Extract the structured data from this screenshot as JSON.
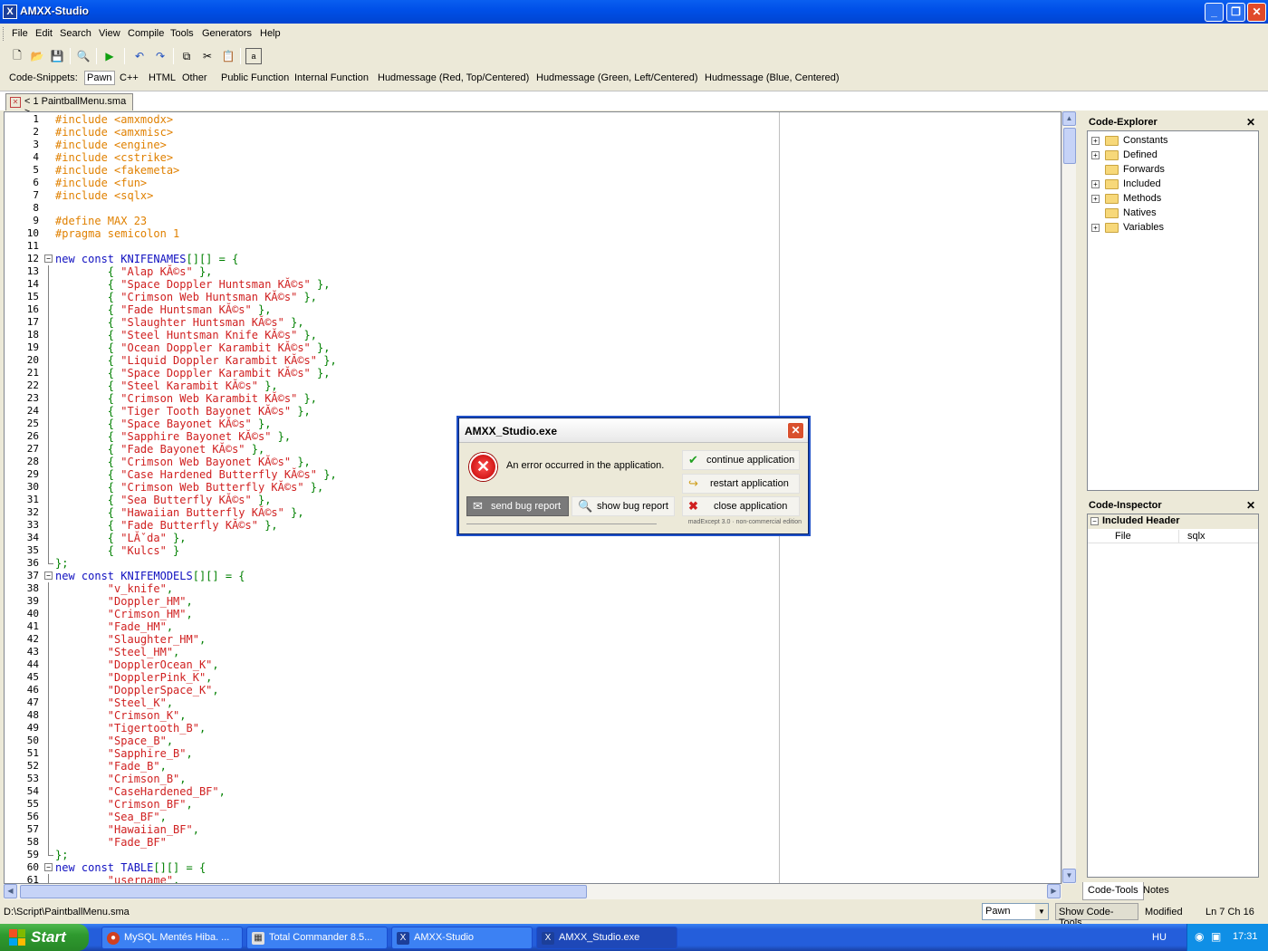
{
  "window": {
    "title": "AMXX-Studio"
  },
  "menu": [
    "File",
    "Edit",
    "Search",
    "View",
    "Compile",
    "Tools",
    "Generators",
    "Help"
  ],
  "toolbar_icons": [
    "new-file-icon",
    "open-folder-icon",
    "save-icon",
    "search-icon",
    "compile-run-icon",
    "undo-icon",
    "redo-icon",
    "copy-icon",
    "cut-icon",
    "paste-icon",
    "select-all-icon"
  ],
  "snippets": {
    "label": "Code-Snippets:",
    "items": [
      "Pawn",
      "C++",
      "HTML",
      "Other",
      "Public Function",
      "Internal Function",
      "Hudmessage (Red, Top/Centered)",
      "Hudmessage (Green, Left/Centered)",
      "Hudmessage (Blue, Centered)"
    ]
  },
  "doc_tab": {
    "label": "< 1 PaintballMenu.sma >"
  },
  "code": [
    [
      {
        "t": "#include <amxmodx>",
        "c": "pre"
      }
    ],
    [
      {
        "t": "#include <amxmisc>",
        "c": "pre"
      }
    ],
    [
      {
        "t": "#include <engine>",
        "c": "pre"
      }
    ],
    [
      {
        "t": "#include <cstrike>",
        "c": "pre"
      }
    ],
    [
      {
        "t": "#include <fakemeta>",
        "c": "pre"
      }
    ],
    [
      {
        "t": "#include <fun>",
        "c": "pre"
      }
    ],
    [
      {
        "t": "#include <sqlx>",
        "c": "pre"
      }
    ],
    [],
    [
      {
        "t": "#define MAX 23",
        "c": "pre"
      }
    ],
    [
      {
        "t": "#pragma semicolon 1",
        "c": "pre"
      }
    ],
    [],
    [
      {
        "t": "new const ",
        "c": "kw"
      },
      {
        "t": "KNIFENAMES",
        "c": "id"
      },
      {
        "t": "[][] = {",
        "c": "op"
      }
    ],
    [
      {
        "t": "        { ",
        "c": "op"
      },
      {
        "t": "\"Alap KĂ©s\"",
        "c": "str"
      },
      {
        "t": " },",
        "c": "op"
      }
    ],
    [
      {
        "t": "        { ",
        "c": "op"
      },
      {
        "t": "\"Space Doppler Huntsman KĂ©s\"",
        "c": "str"
      },
      {
        "t": " },",
        "c": "op"
      }
    ],
    [
      {
        "t": "        { ",
        "c": "op"
      },
      {
        "t": "\"Crimson Web Huntsman KĂ©s\"",
        "c": "str"
      },
      {
        "t": " },",
        "c": "op"
      }
    ],
    [
      {
        "t": "        { ",
        "c": "op"
      },
      {
        "t": "\"Fade Huntsman KĂ©s\"",
        "c": "str"
      },
      {
        "t": " },",
        "c": "op"
      }
    ],
    [
      {
        "t": "        { ",
        "c": "op"
      },
      {
        "t": "\"Slaughter Huntsman KĂ©s\"",
        "c": "str"
      },
      {
        "t": " },",
        "c": "op"
      }
    ],
    [
      {
        "t": "        { ",
        "c": "op"
      },
      {
        "t": "\"Steel Huntsman Knife KĂ©s\"",
        "c": "str"
      },
      {
        "t": " },",
        "c": "op"
      }
    ],
    [
      {
        "t": "        { ",
        "c": "op"
      },
      {
        "t": "\"Ocean Doppler Karambit KĂ©s\"",
        "c": "str"
      },
      {
        "t": " },",
        "c": "op"
      }
    ],
    [
      {
        "t": "        { ",
        "c": "op"
      },
      {
        "t": "\"Liquid Doppler Karambit KĂ©s\"",
        "c": "str"
      },
      {
        "t": " },",
        "c": "op"
      }
    ],
    [
      {
        "t": "        { ",
        "c": "op"
      },
      {
        "t": "\"Space Doppler Karambit KĂ©s\"",
        "c": "str"
      },
      {
        "t": " },",
        "c": "op"
      }
    ],
    [
      {
        "t": "        { ",
        "c": "op"
      },
      {
        "t": "\"Steel Karambit KĂ©s\"",
        "c": "str"
      },
      {
        "t": " },",
        "c": "op"
      }
    ],
    [
      {
        "t": "        { ",
        "c": "op"
      },
      {
        "t": "\"Crimson Web Karambit KĂ©s\"",
        "c": "str"
      },
      {
        "t": " },",
        "c": "op"
      }
    ],
    [
      {
        "t": "        { ",
        "c": "op"
      },
      {
        "t": "\"Tiger Tooth Bayonet KĂ©s\"",
        "c": "str"
      },
      {
        "t": " },",
        "c": "op"
      }
    ],
    [
      {
        "t": "        { ",
        "c": "op"
      },
      {
        "t": "\"Space Bayonet KĂ©s\"",
        "c": "str"
      },
      {
        "t": " },",
        "c": "op"
      }
    ],
    [
      {
        "t": "        { ",
        "c": "op"
      },
      {
        "t": "\"Sapphire Bayonet KĂ©s\"",
        "c": "str"
      },
      {
        "t": " },",
        "c": "op"
      }
    ],
    [
      {
        "t": "        { ",
        "c": "op"
      },
      {
        "t": "\"Fade Bayonet KĂ©s\"",
        "c": "str"
      },
      {
        "t": " },",
        "c": "op"
      }
    ],
    [
      {
        "t": "        { ",
        "c": "op"
      },
      {
        "t": "\"Crimson Web Bayonet KĂ©s\"",
        "c": "str"
      },
      {
        "t": " },",
        "c": "op"
      }
    ],
    [
      {
        "t": "        { ",
        "c": "op"
      },
      {
        "t": "\"Case Hardened Butterfly KĂ©s\"",
        "c": "str"
      },
      {
        "t": " },",
        "c": "op"
      }
    ],
    [
      {
        "t": "        { ",
        "c": "op"
      },
      {
        "t": "\"Crimson Web Butterfly KĂ©s\"",
        "c": "str"
      },
      {
        "t": " },",
        "c": "op"
      }
    ],
    [
      {
        "t": "        { ",
        "c": "op"
      },
      {
        "t": "\"Sea Butterfly KĂ©s\"",
        "c": "str"
      },
      {
        "t": " },",
        "c": "op"
      }
    ],
    [
      {
        "t": "        { ",
        "c": "op"
      },
      {
        "t": "\"Hawaiian Butterfly KĂ©s\"",
        "c": "str"
      },
      {
        "t": " },",
        "c": "op"
      }
    ],
    [
      {
        "t": "        { ",
        "c": "op"
      },
      {
        "t": "\"Fade Butterfly KĂ©s\"",
        "c": "str"
      },
      {
        "t": " },",
        "c": "op"
      }
    ],
    [
      {
        "t": "        { ",
        "c": "op"
      },
      {
        "t": "\"LĂˇda\"",
        "c": "str"
      },
      {
        "t": " },",
        "c": "op"
      }
    ],
    [
      {
        "t": "        { ",
        "c": "op"
      },
      {
        "t": "\"Kulcs\"",
        "c": "str"
      },
      {
        "t": " }",
        "c": "op"
      }
    ],
    [
      {
        "t": "};",
        "c": "op"
      }
    ],
    [
      {
        "t": "new const ",
        "c": "kw"
      },
      {
        "t": "KNIFEMODELS",
        "c": "id"
      },
      {
        "t": "[][] = {",
        "c": "op"
      }
    ],
    [
      {
        "t": "        ",
        "c": "op"
      },
      {
        "t": "\"v_knife\"",
        "c": "str"
      },
      {
        "t": ",",
        "c": "op"
      }
    ],
    [
      {
        "t": "        ",
        "c": "op"
      },
      {
        "t": "\"Doppler_HM\"",
        "c": "str"
      },
      {
        "t": ",",
        "c": "op"
      }
    ],
    [
      {
        "t": "        ",
        "c": "op"
      },
      {
        "t": "\"Crimson_HM\"",
        "c": "str"
      },
      {
        "t": ",",
        "c": "op"
      }
    ],
    [
      {
        "t": "        ",
        "c": "op"
      },
      {
        "t": "\"Fade_HM\"",
        "c": "str"
      },
      {
        "t": ",",
        "c": "op"
      }
    ],
    [
      {
        "t": "        ",
        "c": "op"
      },
      {
        "t": "\"Slaughter_HM\"",
        "c": "str"
      },
      {
        "t": ",",
        "c": "op"
      }
    ],
    [
      {
        "t": "        ",
        "c": "op"
      },
      {
        "t": "\"Steel_HM\"",
        "c": "str"
      },
      {
        "t": ",",
        "c": "op"
      }
    ],
    [
      {
        "t": "        ",
        "c": "op"
      },
      {
        "t": "\"DopplerOcean_K\"",
        "c": "str"
      },
      {
        "t": ",",
        "c": "op"
      }
    ],
    [
      {
        "t": "        ",
        "c": "op"
      },
      {
        "t": "\"DopplerPink_K\"",
        "c": "str"
      },
      {
        "t": ",",
        "c": "op"
      }
    ],
    [
      {
        "t": "        ",
        "c": "op"
      },
      {
        "t": "\"DopplerSpace_K\"",
        "c": "str"
      },
      {
        "t": ",",
        "c": "op"
      }
    ],
    [
      {
        "t": "        ",
        "c": "op"
      },
      {
        "t": "\"Steel_K\"",
        "c": "str"
      },
      {
        "t": ",",
        "c": "op"
      }
    ],
    [
      {
        "t": "        ",
        "c": "op"
      },
      {
        "t": "\"Crimson_K\"",
        "c": "str"
      },
      {
        "t": ",",
        "c": "op"
      }
    ],
    [
      {
        "t": "        ",
        "c": "op"
      },
      {
        "t": "\"Tigertooth_B\"",
        "c": "str"
      },
      {
        "t": ",",
        "c": "op"
      }
    ],
    [
      {
        "t": "        ",
        "c": "op"
      },
      {
        "t": "\"Space_B\"",
        "c": "str"
      },
      {
        "t": ",",
        "c": "op"
      }
    ],
    [
      {
        "t": "        ",
        "c": "op"
      },
      {
        "t": "\"Sapphire_B\"",
        "c": "str"
      },
      {
        "t": ",",
        "c": "op"
      }
    ],
    [
      {
        "t": "        ",
        "c": "op"
      },
      {
        "t": "\"Fade_B\"",
        "c": "str"
      },
      {
        "t": ",",
        "c": "op"
      }
    ],
    [
      {
        "t": "        ",
        "c": "op"
      },
      {
        "t": "\"Crimson_B\"",
        "c": "str"
      },
      {
        "t": ",",
        "c": "op"
      }
    ],
    [
      {
        "t": "        ",
        "c": "op"
      },
      {
        "t": "\"CaseHardened_BF\"",
        "c": "str"
      },
      {
        "t": ",",
        "c": "op"
      }
    ],
    [
      {
        "t": "        ",
        "c": "op"
      },
      {
        "t": "\"Crimson_BF\"",
        "c": "str"
      },
      {
        "t": ",",
        "c": "op"
      }
    ],
    [
      {
        "t": "        ",
        "c": "op"
      },
      {
        "t": "\"Sea_BF\"",
        "c": "str"
      },
      {
        "t": ",",
        "c": "op"
      }
    ],
    [
      {
        "t": "        ",
        "c": "op"
      },
      {
        "t": "\"Hawaiian_BF\"",
        "c": "str"
      },
      {
        "t": ",",
        "c": "op"
      }
    ],
    [
      {
        "t": "        ",
        "c": "op"
      },
      {
        "t": "\"Fade_BF\"",
        "c": "str"
      }
    ],
    [
      {
        "t": "};",
        "c": "op"
      }
    ],
    [
      {
        "t": "new const ",
        "c": "kw"
      },
      {
        "t": "TABLE",
        "c": "id"
      },
      {
        "t": "[][] = {",
        "c": "op"
      }
    ],
    [
      {
        "t": "        ",
        "c": "op"
      },
      {
        "t": "\"username\"",
        "c": "str"
      },
      {
        "t": ",",
        "c": "op"
      }
    ]
  ],
  "code_explorer": {
    "title": "Code-Explorer",
    "items": [
      {
        "label": "Constants",
        "expandable": true
      },
      {
        "label": "Defined",
        "expandable": true
      },
      {
        "label": "Forwards",
        "expandable": false
      },
      {
        "label": "Included",
        "expandable": true
      },
      {
        "label": "Methods",
        "expandable": true
      },
      {
        "label": "Natives",
        "expandable": false
      },
      {
        "label": "Variables",
        "expandable": true
      }
    ]
  },
  "code_inspector": {
    "title": "Code-Inspector",
    "group": "Included Header",
    "row": {
      "key": "File",
      "value": "sqlx"
    }
  },
  "right_tabs": [
    "Code-Tools",
    "Notes"
  ],
  "status": {
    "path": "D:\\Script\\PaintballMenu.sma",
    "language": "Pawn",
    "show_tools": "Show Code-Tools",
    "modified": "Modified",
    "position": "Ln 7 Ch 16"
  },
  "dialog": {
    "title": "AMXX_Studio.exe",
    "message": "An error occurred in the application.",
    "continue": "continue application",
    "restart": "restart application",
    "close": "close application",
    "send": "send bug report",
    "show": "show bug report",
    "footer": "madExcept 3.0 · non-commercial edition"
  },
  "taskbar": {
    "start": "Start",
    "tasks": [
      "MySQL Mentés Hiba. ...",
      "Total Commander 8.5...",
      "AMXX-Studio",
      "AMXX_Studio.exe"
    ],
    "lang": "HU",
    "clock": "17:31"
  }
}
